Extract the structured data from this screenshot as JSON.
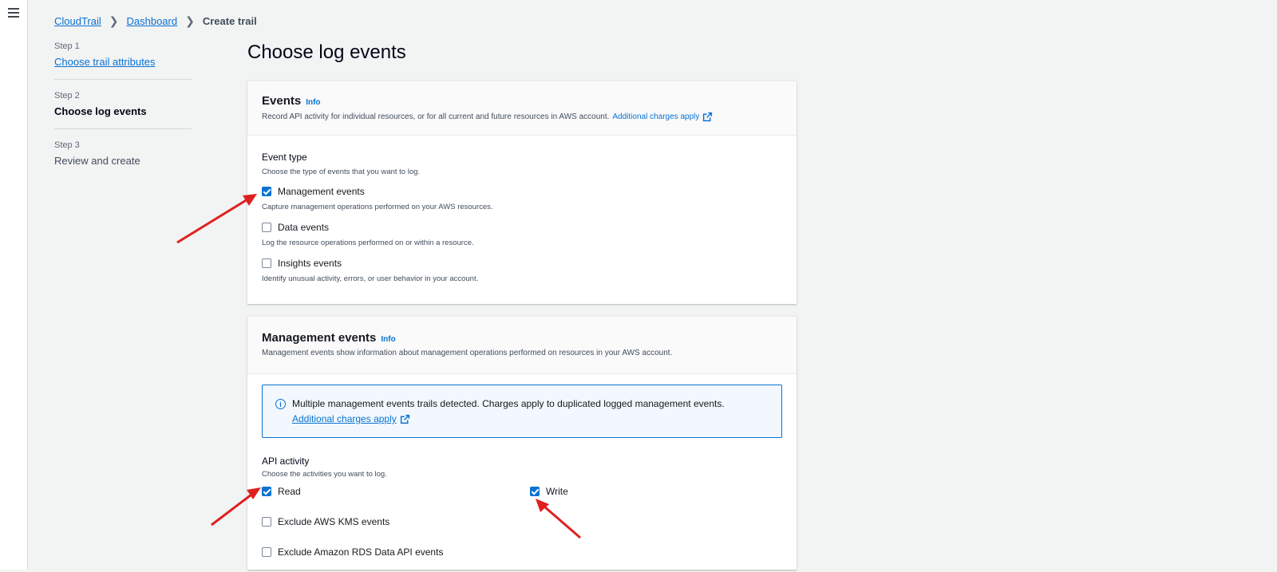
{
  "breadcrumb": {
    "items": [
      "CloudTrail",
      "Dashboard"
    ],
    "current": "Create trail"
  },
  "steps": [
    {
      "num": "Step 1",
      "title": "Choose trail attributes"
    },
    {
      "num": "Step 2",
      "title": "Choose log events"
    },
    {
      "num": "Step 3",
      "title": "Review and create"
    }
  ],
  "page_title": "Choose log events",
  "events_card": {
    "title": "Events",
    "info": "Info",
    "desc": "Record API activity for individual resources, or for all current and future resources in AWS account.",
    "link": "Additional charges apply",
    "event_type_label": "Event type",
    "event_type_desc": "Choose the type of events that you want to log.",
    "options": [
      {
        "label": "Management events",
        "desc": "Capture management operations performed on your AWS resources.",
        "checked": true
      },
      {
        "label": "Data events",
        "desc": "Log the resource operations performed on or within a resource.",
        "checked": false
      },
      {
        "label": "Insights events",
        "desc": "Identify unusual activity, errors, or user behavior in your account.",
        "checked": false
      }
    ]
  },
  "mgmt_card": {
    "title": "Management events",
    "info": "Info",
    "desc": "Management events show information about management operations performed on resources in your AWS account.",
    "alert_text": "Multiple management events trails detected. Charges apply to duplicated logged management events.",
    "alert_link": "Additional charges apply",
    "api_label": "API activity",
    "api_desc": "Choose the activities you want to log.",
    "read_label": "Read",
    "write_label": "Write",
    "exclude_kms": "Exclude AWS KMS events",
    "exclude_rds": "Exclude Amazon RDS Data API events"
  },
  "colors": {
    "accent": "#0972d3",
    "annotation_arrow": "#e02020"
  }
}
